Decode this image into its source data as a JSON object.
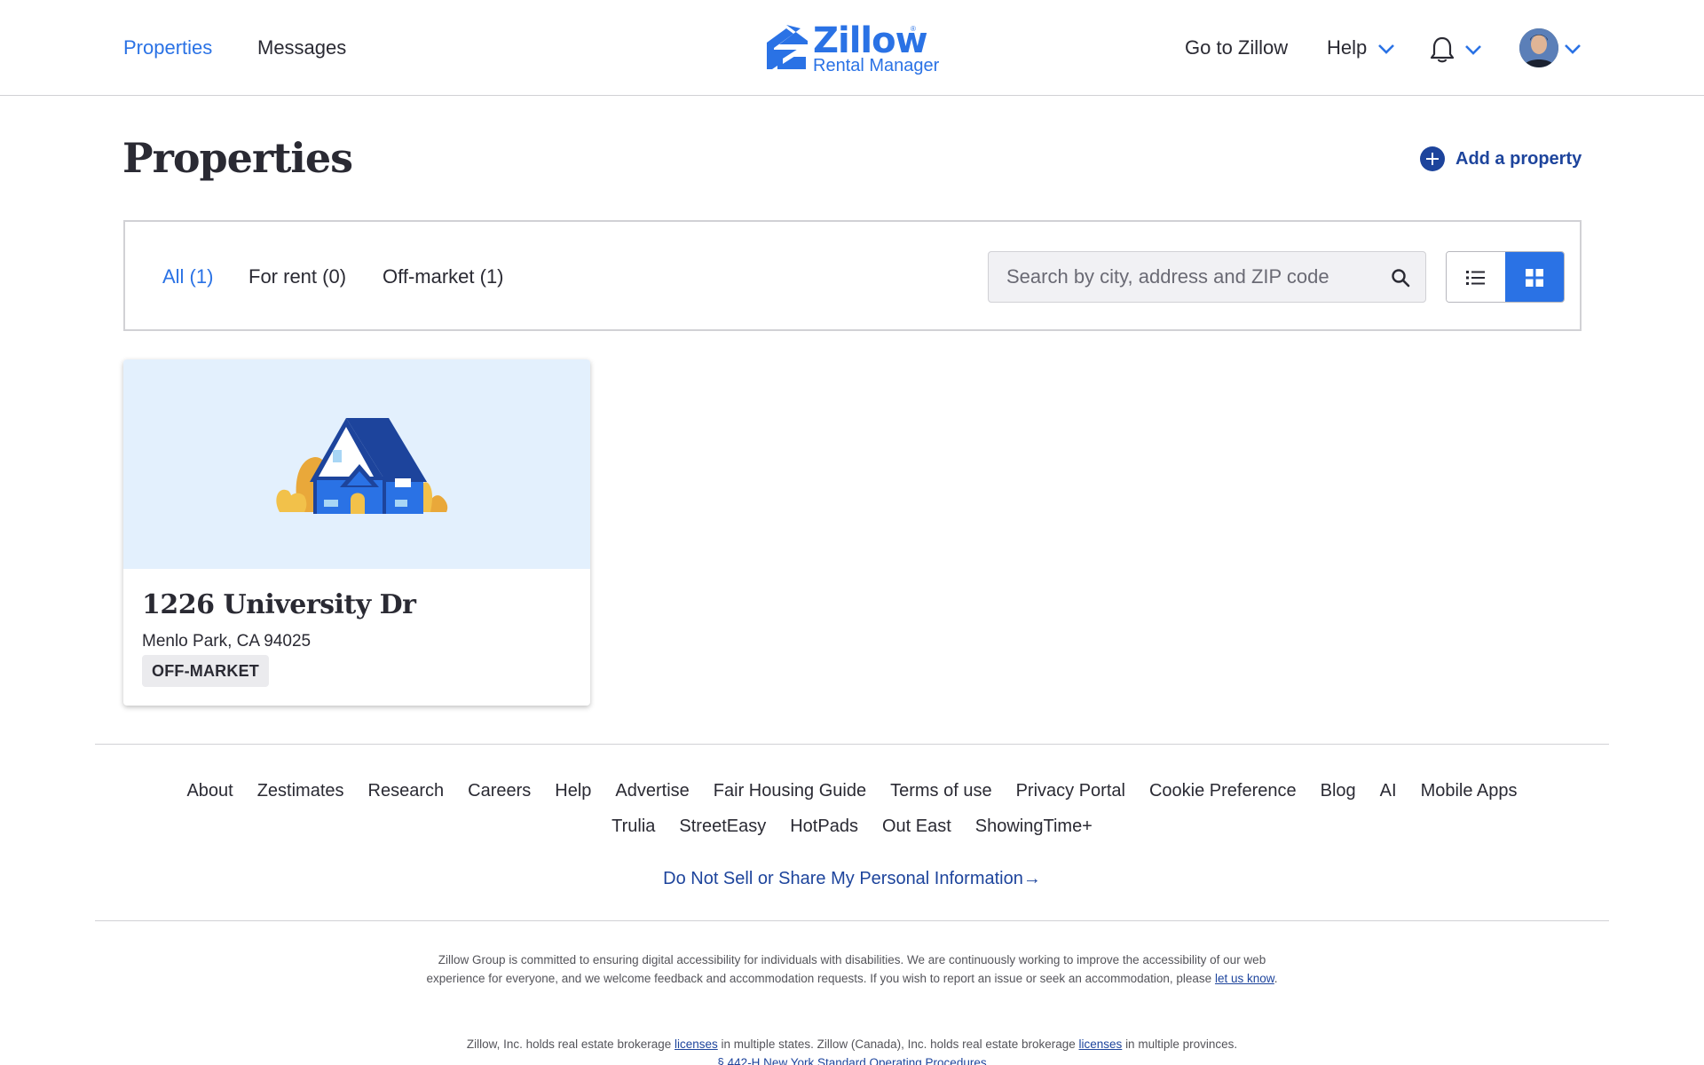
{
  "header": {
    "nav": [
      "Properties",
      "Messages"
    ],
    "logo_word": "Zillow",
    "logo_sub": "Rental Manager",
    "logo_reg": "®",
    "go_to_zillow": "Go to Zillow",
    "help": "Help"
  },
  "page": {
    "title": "Properties",
    "add_property": "Add a property"
  },
  "filters": {
    "tabs": [
      "All (1)",
      "For rent (0)",
      "Off-market (1)"
    ],
    "active_tab": "All (1)",
    "search_placeholder": "Search by city, address and ZIP code",
    "search_value": "",
    "view_mode": "grid"
  },
  "properties": [
    {
      "address": "1226 University Dr",
      "city_state_zip": "Menlo Park, CA 94025",
      "status": "OFF-MARKET"
    }
  ],
  "footer": {
    "links_row1": [
      "About",
      "Zestimates",
      "Research",
      "Careers",
      "Help",
      "Advertise",
      "Fair Housing Guide",
      "Terms of use",
      "Privacy Portal",
      "Cookie Preference",
      "Blog",
      "AI",
      "Mobile Apps"
    ],
    "links_row2": [
      "Trulia",
      "StreetEasy",
      "HotPads",
      "Out East",
      "ShowingTime+"
    ],
    "do_not_sell": "Do Not Sell or Share My Personal Information→",
    "accessibility_text": "Zillow Group is committed to ensuring digital accessibility for individuals with disabilities. We are continuously working to improve the accessibility of our web experience for everyone, and we welcome feedback and accommodation requests. If you wish to report an issue or seek an accommodation, please",
    "let_us_know": "let us know",
    "period": ".",
    "licenses_part1": "Zillow, Inc. holds real estate brokerage",
    "licenses_link": "licenses",
    "licenses_part2": "in multiple states. Zillow (Canada), Inc. holds real estate brokerage",
    "licenses_part3": "in multiple provinces.",
    "sop_link": "§ 442-H New York Standard Operating Procedures"
  },
  "colors": {
    "brand_blue": "#2a72e5",
    "navy": "#1d449c",
    "text": "#2a2a33",
    "card_image_bg": "#e3f0fd"
  },
  "icons": [
    "chevron-down-icon",
    "bell-icon",
    "plus-circle-icon",
    "search-icon",
    "list-view-icon",
    "grid-view-icon",
    "house-illustration"
  ]
}
